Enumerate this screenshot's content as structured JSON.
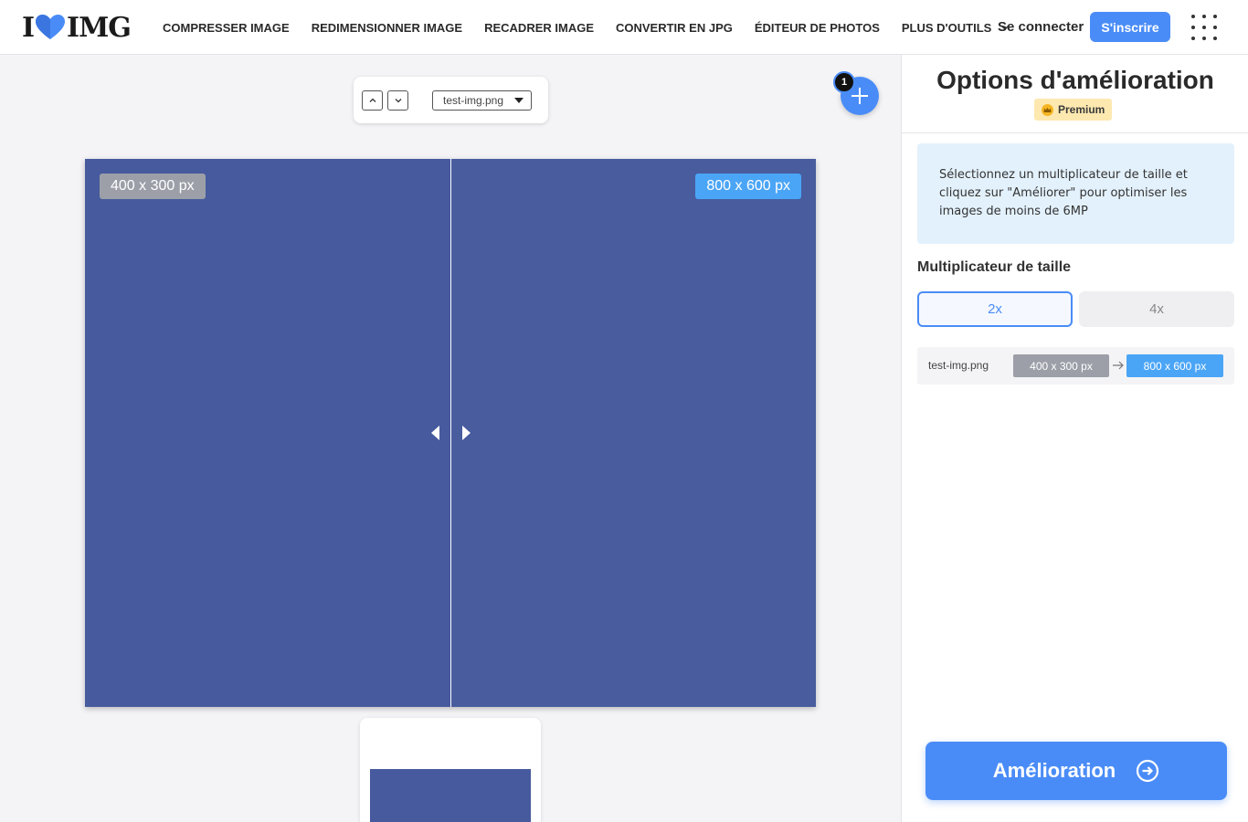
{
  "header": {
    "logo_left": "I",
    "logo_right": "IMG",
    "nav": [
      {
        "label": "COMPRESSER IMAGE"
      },
      {
        "label": "REDIMENSIONNER IMAGE"
      },
      {
        "label": "RECADRER IMAGE"
      },
      {
        "label": "CONVERTIR EN JPG"
      },
      {
        "label": "ÉDITEUR DE PHOTOS"
      },
      {
        "label": "PLUS D'OUTILS"
      }
    ],
    "login": "Se connecter",
    "signup": "S'inscrire"
  },
  "workarea": {
    "file_select": "test-img.png",
    "file_count": "1",
    "original_size": "400 x 300 px",
    "enhanced_size": "800 x 600 px"
  },
  "panel": {
    "title": "Options d'amélioration",
    "premium": "Premium",
    "info": "Sélectionnez un multiplicateur de taille et cliquez sur \"Améliorer\" pour optimiser les images de moins de 6MP",
    "multiplier_label": "Multiplicateur de taille",
    "multipliers": [
      {
        "label": "2x",
        "selected": true
      },
      {
        "label": "4x",
        "selected": false
      }
    ],
    "file_row": {
      "name": "test-img.png",
      "from": "400 x 300 px",
      "to": "800 x 600 px"
    },
    "enhance_button": "Amélioration"
  },
  "colors": {
    "accent": "#4a8cf7",
    "image_fill": "#465a9d",
    "badge_gray": "#9c9fa8",
    "badge_blue": "#4ba5f6",
    "premium_bg": "#fde8b0"
  }
}
